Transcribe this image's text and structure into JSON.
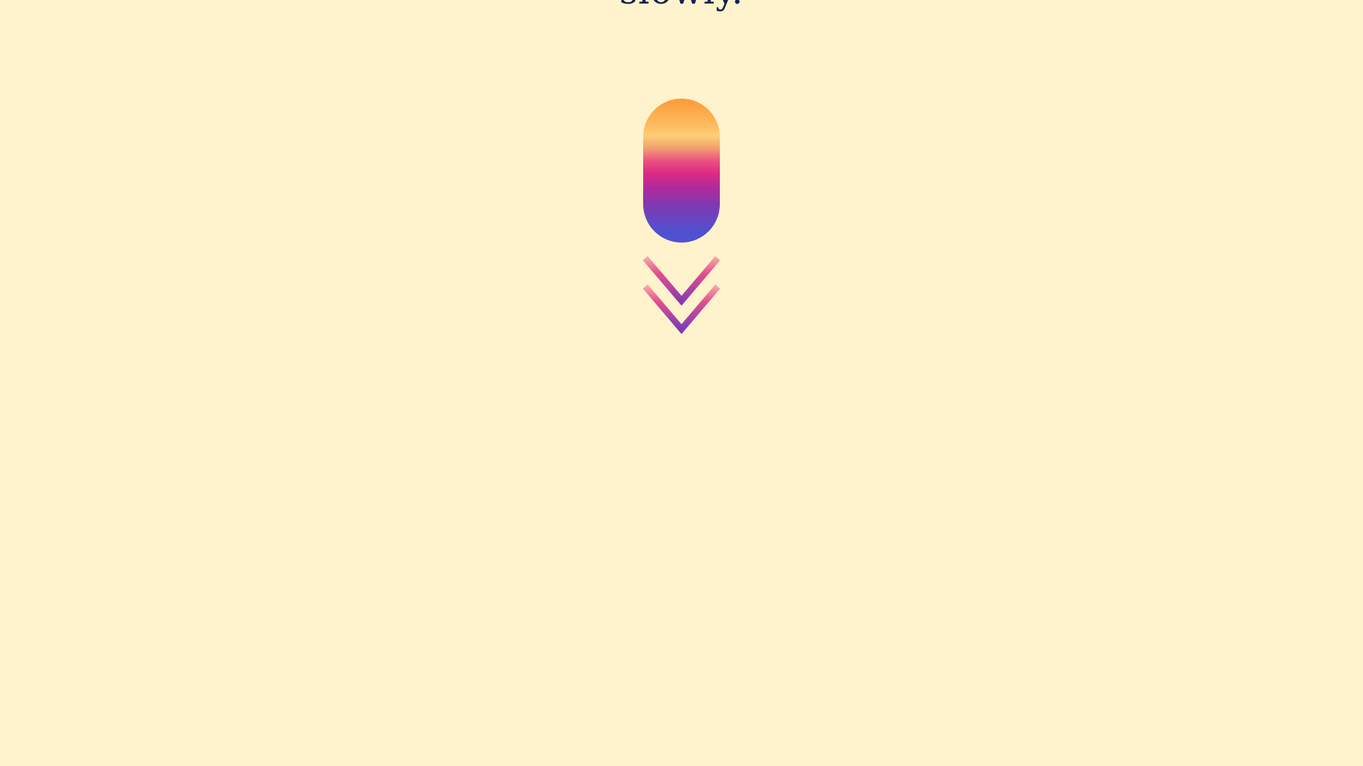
{
  "page": {
    "background_color": "#fef3cc",
    "headline_color": "#14234f"
  },
  "hero": {
    "headline_fragment": "slowly."
  },
  "scroll_indicator": {
    "pill_gradient_colors": [
      "#fb9a38",
      "#fdbe63",
      "#ea4c83",
      "#dc2a86",
      "#7d3ab4",
      "#4d52d0"
    ],
    "chevron_colors": [
      "#f3a0a0",
      "#dc2a86",
      "#7d3ab4"
    ],
    "icon": "double-chevron-down-icon"
  }
}
